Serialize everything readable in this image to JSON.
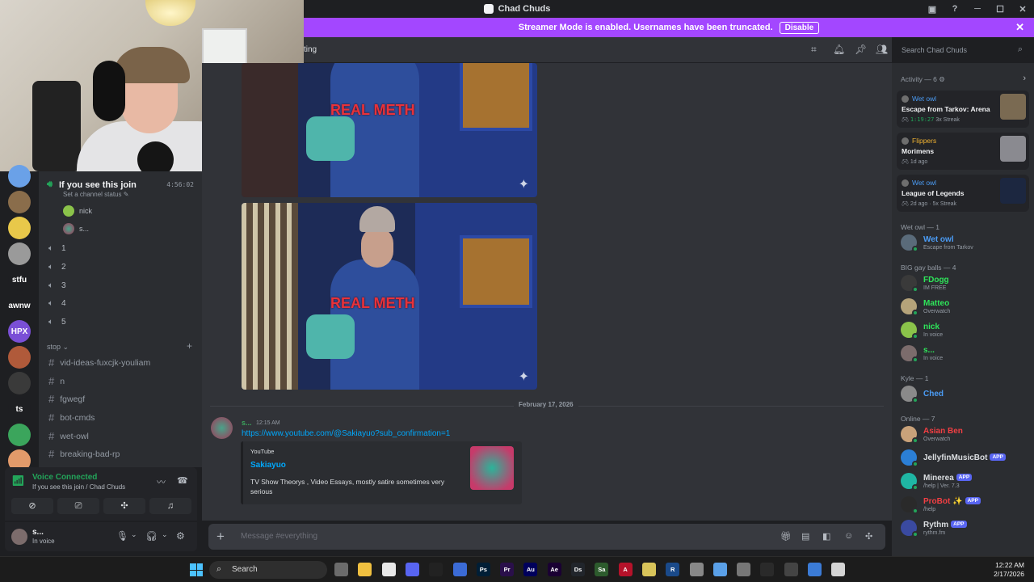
{
  "window": {
    "title": "Chad Chuds"
  },
  "streamer_banner": {
    "text": "Streamer Mode is enabled. Usernames have been truncated.",
    "button": "Disable"
  },
  "topbar": {
    "channel_partial": "ting",
    "search_placeholder": "Search Chad Chuds"
  },
  "guilds": [
    {
      "label": "",
      "color": "#6aa1e8"
    },
    {
      "label": "",
      "color": "#8a6d4b"
    },
    {
      "label": "",
      "color": "#e8c84a"
    },
    {
      "label": "",
      "color": "#9a9a9a"
    },
    {
      "label": "stfu",
      "color": "#1e1f22"
    },
    {
      "label": "awnw",
      "color": "#1e1f22"
    },
    {
      "label": "HPX",
      "color": "#7a4fd6"
    },
    {
      "label": "",
      "color": "#b05a3a"
    },
    {
      "label": "",
      "color": "#3a3a3a"
    },
    {
      "label": "ts",
      "color": "#1e1f22"
    },
    {
      "label": "",
      "color": "#3ba55c"
    },
    {
      "label": "",
      "color": "#e29a6a"
    }
  ],
  "voice_channel": {
    "name": "If you see this join",
    "status": "Set a channel status",
    "timer": "4:56:02",
    "users": [
      "nick",
      "s..."
    ]
  },
  "speakers": [
    "1",
    "2",
    "3",
    "4",
    "5"
  ],
  "category": "stop",
  "text_channels": [
    "vid-ideas-fuxcjk-youliam",
    "n",
    "fgwegf",
    "bot-cmds",
    "wet-owl",
    "breaking-bad-rp"
  ],
  "voice_panel": {
    "title": "Voice Connected",
    "subtitle": "If you see this join / Chad Chuds"
  },
  "user_panel": {
    "name": "s...",
    "status": "In voice"
  },
  "images": {
    "caption": "REAL METH"
  },
  "chat": {
    "date_divider": "February 17, 2026",
    "message": {
      "author": "s...",
      "time": "12:15 AM",
      "link": "https://www.youtube.com/@Sakiayuo?sub_confirmation=1",
      "embed": {
        "provider": "YouTube",
        "title": "Sakiayuo",
        "description": "TV Show Theorys , Video Essays, mostly satire sometimes very serious"
      }
    },
    "composer_placeholder": "Message #everything"
  },
  "activity": {
    "header": "Activity — 6",
    "cards": [
      {
        "user": "Wet owl",
        "user_color": "#4b9cf5",
        "game": "Escape from Tarkov: Arena",
        "time": "1:19:27",
        "meta": "3x Streak"
      },
      {
        "user": "Flippers",
        "user_color": "#f0b232",
        "game": "Morimens",
        "time": "",
        "meta": "1d ago"
      },
      {
        "user": "Wet owl",
        "user_color": "#4b9cf5",
        "game": "League of Legends",
        "time": "",
        "meta": "2d ago  ·  5x Streak"
      }
    ]
  },
  "members": {
    "groups": [
      {
        "name": "Wet owl — 1",
        "members": [
          {
            "name": "Wet owl",
            "color": "#4b9cf5",
            "status": "Escape from Tarkov",
            "app": false
          }
        ]
      },
      {
        "name": "BIG gay balls — 4",
        "members": [
          {
            "name": "FDogg",
            "color": "#2ee65a",
            "status": "IM FREE",
            "app": false
          },
          {
            "name": "Matteo",
            "color": "#2ee65a",
            "status": "Overwatch",
            "app": false
          },
          {
            "name": "nick",
            "color": "#2ee65a",
            "status": "In voice",
            "app": false
          },
          {
            "name": "s...",
            "color": "#2ee65a",
            "status": "In voice",
            "app": false
          }
        ]
      },
      {
        "name": "Kyle — 1",
        "members": [
          {
            "name": "Ched",
            "color": "#4b9cf5",
            "status": "",
            "app": false
          }
        ]
      },
      {
        "name": "Online — 7",
        "members": [
          {
            "name": "Asian Ben",
            "color": "#f23f43",
            "status": "Overwatch",
            "app": false
          },
          {
            "name": "JellyfinMusicBot",
            "color": "#dbdee1",
            "status": "",
            "app": true
          },
          {
            "name": "Minerea",
            "color": "#dbdee1",
            "status": "/help | Ver. 7.3",
            "app": true
          },
          {
            "name": "ProBot ✨",
            "color": "#f23f43",
            "status": "/help",
            "app": true
          },
          {
            "name": "Rythm",
            "color": "#dbdee1",
            "status": "rythm.fm",
            "app": true
          }
        ]
      }
    ],
    "app_tag": "APP"
  },
  "taskbar": {
    "search": "Search",
    "apps": [
      "",
      "",
      "",
      "",
      "",
      "",
      "Ps",
      "Pr",
      "Au",
      "Ae",
      "Ds",
      "Sa",
      "A",
      "",
      "R",
      "",
      "",
      "",
      "",
      "",
      "",
      ""
    ],
    "time": "12:22 AM",
    "date": "2/17/2026"
  }
}
